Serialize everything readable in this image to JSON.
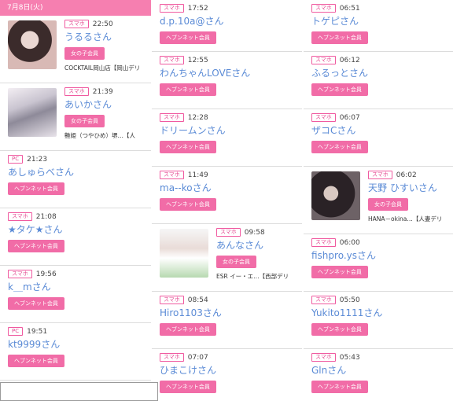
{
  "header": {
    "date": "7月8日(火)"
  },
  "labels": {
    "girl_member": "女の子会員",
    "heaven_member": "ヘブンネット会員"
  },
  "colors": {
    "accent_pink": "#f67fb0",
    "name_blue": "#5b8bd6"
  },
  "columns": [
    [
      {
        "device": "スマホ",
        "time": "22:50",
        "name": "うるるさん",
        "badge": "女の子会員",
        "shop": "COCKTAIL岡山店【岡山デリ",
        "photo": "photo-a"
      },
      {
        "device": "スマホ",
        "time": "21:39",
        "name": "あいかさん",
        "badge": "女の子会員",
        "shop": "艶姫（つやひめ）堺…【人",
        "photo": "photo-b"
      },
      {
        "device": "PC",
        "time": "21:23",
        "name": "あしゅらべさん",
        "badge": "ヘブンネット会員"
      },
      {
        "device": "スマホ",
        "time": "21:08",
        "name": "★タケ★さん",
        "badge": "ヘブンネット会員"
      },
      {
        "device": "スマホ",
        "time": "19:56",
        "name": "k＿mさん",
        "badge": "ヘブンネット会員"
      },
      {
        "device": "PC",
        "time": "19:51",
        "name": "kt9999さん",
        "badge": "ヘブンネット会員"
      }
    ],
    [
      {
        "device": "スマホ",
        "time": "17:52",
        "name": "d.p.10a@さん",
        "badge": "ヘブンネット会員"
      },
      {
        "device": "スマホ",
        "time": "12:55",
        "name": "わんちゃんLOVEさん",
        "badge": "ヘブンネット会員"
      },
      {
        "device": "スマホ",
        "time": "12:28",
        "name": "ドリームンさん",
        "badge": "ヘブンネット会員"
      },
      {
        "device": "スマホ",
        "time": "11:49",
        "name": "ma--koさん",
        "badge": "ヘブンネット会員"
      },
      {
        "device": "スマホ",
        "time": "09:58",
        "name": "あんなさん",
        "badge": "女の子会員",
        "shop": "ESR イー・エ…【西部デリ",
        "photo": "photo-c"
      },
      {
        "device": "スマホ",
        "time": "08:54",
        "name": "Hiro1103さん",
        "badge": "ヘブンネット会員"
      },
      {
        "device": "スマホ",
        "time": "07:07",
        "name": "ひまこけさん",
        "badge": "ヘブンネット会員"
      }
    ],
    [
      {
        "device": "スマホ",
        "time": "06:51",
        "name": "トゲピさん",
        "badge": "ヘブンネット会員"
      },
      {
        "device": "スマホ",
        "time": "06:12",
        "name": "ふるっとさん",
        "badge": "ヘブンネット会員"
      },
      {
        "device": "スマホ",
        "time": "06:07",
        "name": "ザコCさん",
        "badge": "ヘブンネット会員"
      },
      {
        "device": "スマホ",
        "time": "06:02",
        "name": "天野 ひすいさん",
        "badge": "女の子会員",
        "shop": "HANA－okina…【人妻デリ",
        "photo": "photo-d"
      },
      {
        "device": "スマホ",
        "time": "06:00",
        "name": "fishpro.ysさん",
        "badge": "ヘブンネット会員"
      },
      {
        "device": "スマホ",
        "time": "05:50",
        "name": "Yukito1111さん",
        "badge": "ヘブンネット会員"
      },
      {
        "device": "スマホ",
        "time": "05:43",
        "name": "Glnさん",
        "badge": "ヘブンネット会員"
      }
    ]
  ]
}
